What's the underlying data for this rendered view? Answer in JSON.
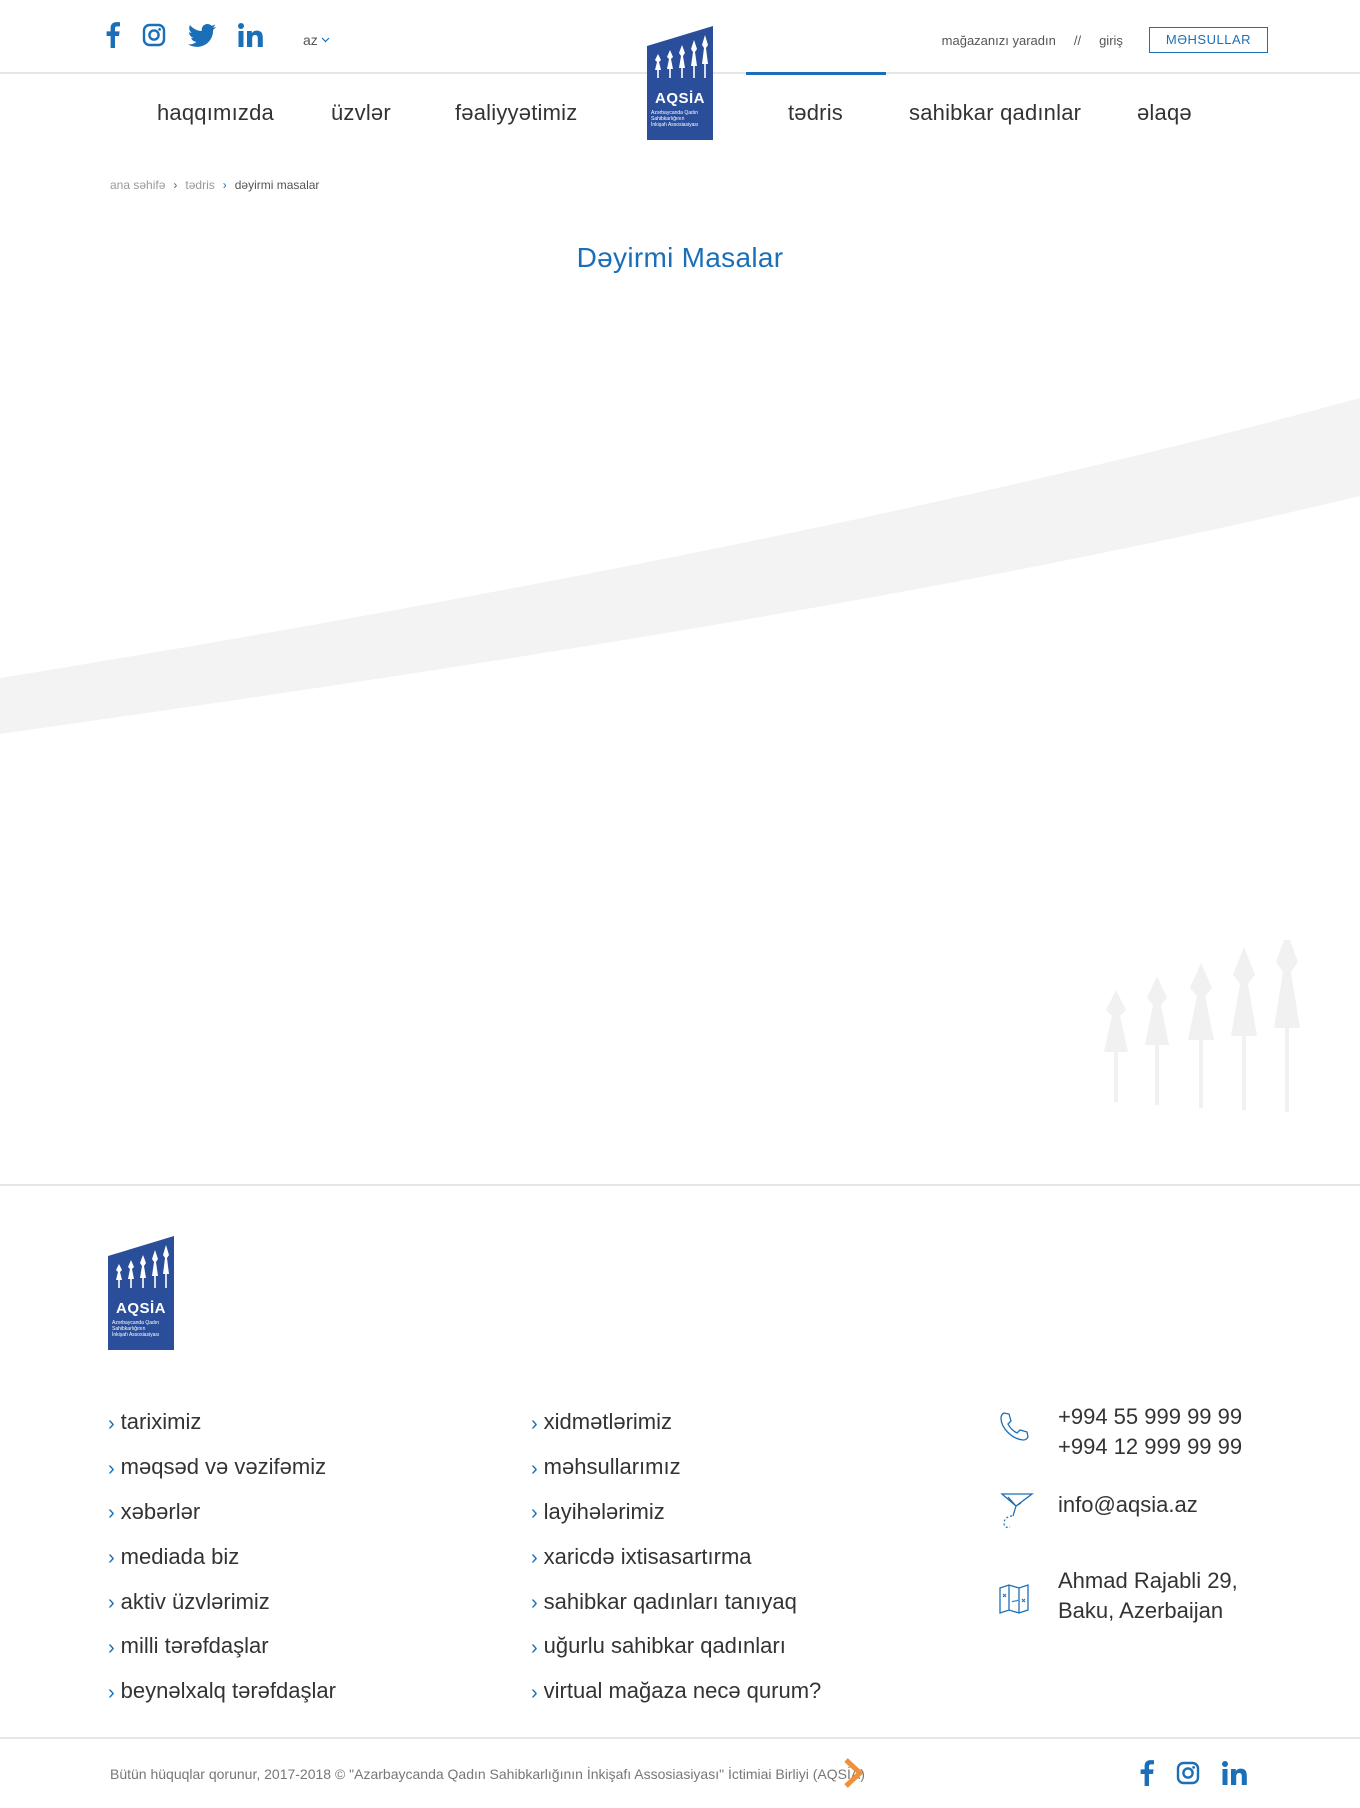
{
  "header": {
    "socials": [
      "facebook-icon",
      "instagram-icon",
      "twitter-icon",
      "linkedin-icon"
    ],
    "lang": "az",
    "create_store": "mağazanızı yaradın",
    "separator": "//",
    "login": "giriş",
    "products_button": "MƏHSULLAR"
  },
  "logo": {
    "name": "AQSİA",
    "subtitle_lines": [
      "Azərbaycanda Qadın",
      "Sahibkarlığının",
      "İnkişafı Assosiasiyası"
    ]
  },
  "nav": {
    "items": [
      "haqqımızda",
      "üzvlər",
      "fəaliyyətimiz",
      "tədris",
      "sahibkar qadınlar",
      "əlaqə"
    ],
    "active": "tədris"
  },
  "breadcrumb": {
    "items": [
      "ana səhifə",
      "tədris"
    ],
    "current": "dəyirmi masalar"
  },
  "page": {
    "title": "Dəyirmi Masalar"
  },
  "footer": {
    "col1": [
      "tariximiz",
      "məqsəd və vəzifəmiz",
      "xəbərlər",
      "mediada biz",
      "aktiv üzvlərimiz",
      "milli tərəfdaşlar",
      "beynəlxalq tərəfdaşlar"
    ],
    "col2": [
      "xidmətlərimiz",
      "məhsullarımız",
      "layihələrimiz",
      "xaricdə ixtisasartırma",
      "sahibkar qadınları tanıyaq",
      "uğurlu sahibkar qadınları",
      "virtual mağaza necə qurum?"
    ],
    "contacts": {
      "phone1": "+994 55 999 99 99",
      "phone2": "+994 12 999 99 99",
      "email": "info@aqsia.az",
      "address1": "Ahmad Rajabli 29,",
      "address2": "Baku, Azerbaijan"
    },
    "copyright": "Bütün hüquqlar qorunur, 2017-2018 © \"Azarbaycanda Qadın Sahibkarlığının İnkişafı Assosiasiyası\" İctimiai Birliyi (AQSİA)",
    "socials": [
      "facebook-icon",
      "instagram-icon",
      "linkedin-icon"
    ]
  },
  "colors": {
    "brand_blue": "#1b6fb8",
    "logo_blue": "#2a4e9a",
    "accent_orange": "#f0913a",
    "wave_gray": "#f3f3f3"
  }
}
